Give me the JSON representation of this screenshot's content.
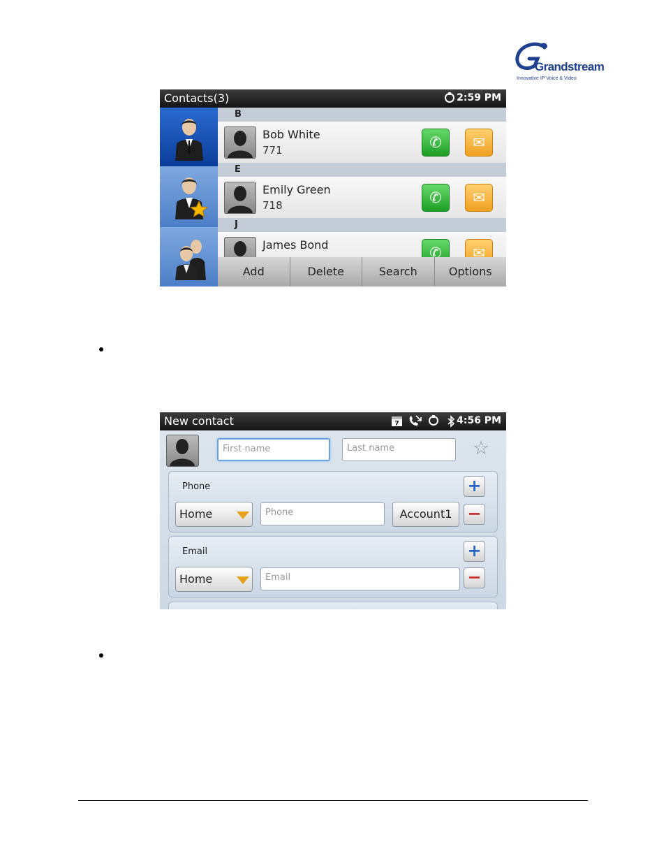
{
  "logo": {
    "brand": "Grandstream",
    "tagline": "Innovative IP Voice & Video"
  },
  "contacts_screen": {
    "title": "Contacts(3)",
    "time": "2:59 PM",
    "sections": [
      {
        "letter": "B",
        "contact": {
          "name": "Bob White",
          "number": "771"
        }
      },
      {
        "letter": "E",
        "contact": {
          "name": "Emily Green",
          "number": "718"
        }
      },
      {
        "letter": "J",
        "contact": {
          "name": "James Bond",
          "number": ""
        }
      }
    ],
    "bottom_buttons": [
      "Add",
      "Delete",
      "Search",
      "Options"
    ]
  },
  "new_contact_screen": {
    "title": "New contact",
    "time": "4:56 PM",
    "first_name_placeholder": "First name",
    "last_name_placeholder": "Last name",
    "phone": {
      "label": "Phone",
      "type": "Home",
      "placeholder": "Phone",
      "account": "Account1",
      "add": "+",
      "remove": "−"
    },
    "email": {
      "label": "Email",
      "type": "Home",
      "placeholder": "Email",
      "add": "+",
      "remove": "−"
    }
  }
}
